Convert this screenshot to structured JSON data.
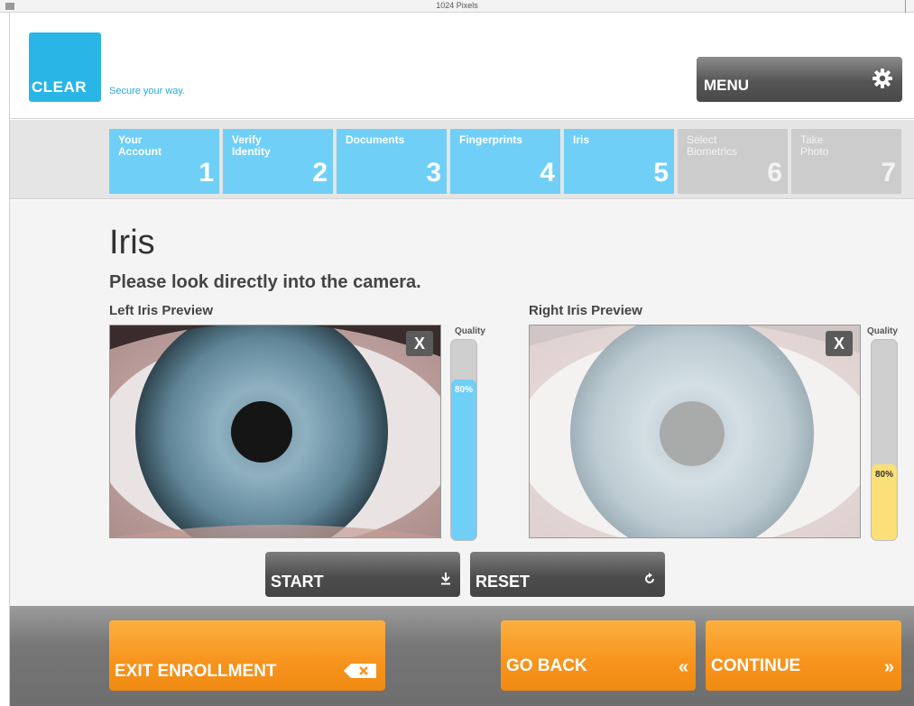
{
  "ruler": {
    "label": "1024 Pixels"
  },
  "header": {
    "logo_text": "CLEAR",
    "tagline": "Secure your way.",
    "menu_label": "MENU"
  },
  "steps": [
    {
      "name": "Your\nAccount",
      "number": "1",
      "state": "complete"
    },
    {
      "name": "Verify\nIdentity",
      "number": "2",
      "state": "complete"
    },
    {
      "name": "Documents",
      "number": "3",
      "state": "complete"
    },
    {
      "name": "Fingerprints",
      "number": "4",
      "state": "complete"
    },
    {
      "name": "Iris",
      "number": "5",
      "state": "active"
    },
    {
      "name": "Select\nBiometrics",
      "number": "6",
      "state": "inactive"
    },
    {
      "name": "Take\nPhoto",
      "number": "7",
      "state": "inactive"
    }
  ],
  "main": {
    "title": "Iris",
    "instruction": "Please look directly into the camera.",
    "left": {
      "title": "Left Iris Preview",
      "close_label": "X",
      "quality_label": "Quality",
      "quality_text": "80%",
      "quality_fraction": 0.8,
      "quality_color": "#6fcff7"
    },
    "right": {
      "title": "Right Iris Preview",
      "close_label": "X",
      "quality_label": "Quality",
      "quality_text": "80%",
      "quality_fraction": 0.38,
      "quality_color": "#fbe07a"
    },
    "start_label": "START",
    "reset_label": "RESET"
  },
  "footer": {
    "exit_label": "EXIT ENROLLMENT",
    "back_label": "GO BACK",
    "back_icon": "«",
    "continue_label": "CONTINUE",
    "continue_icon": "»"
  },
  "colors": {
    "brand": "#29b6e6",
    "step_active": "#6fcff7",
    "step_inactive": "#cccccc",
    "orange": "#f7941d"
  }
}
